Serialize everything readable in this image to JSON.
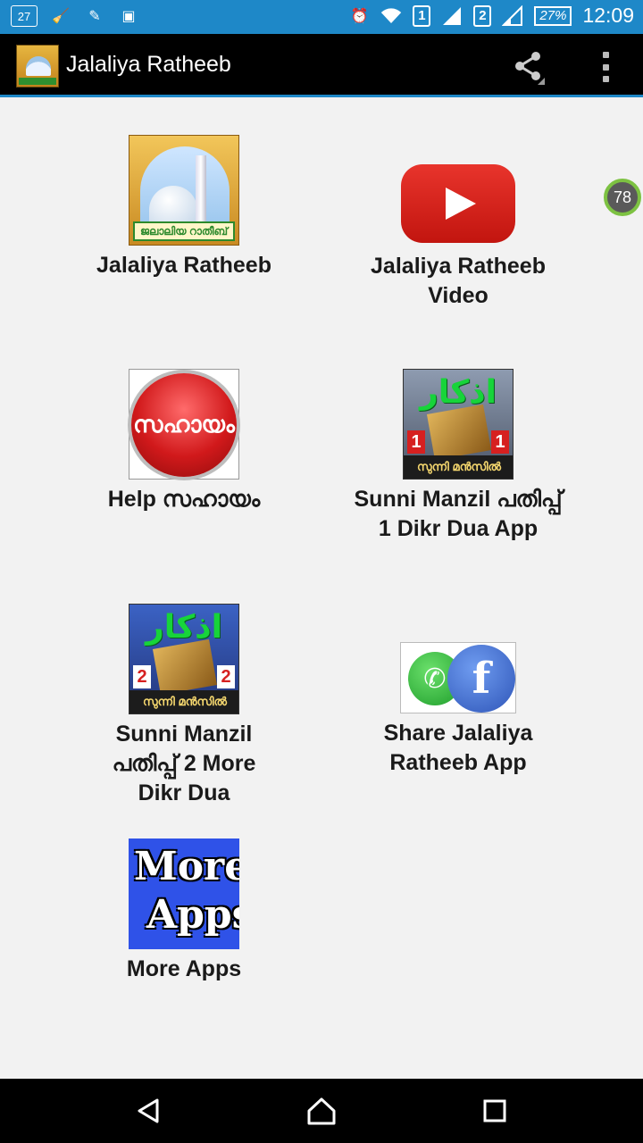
{
  "status_bar": {
    "notification_count": "27",
    "battery": "27%",
    "time": "12:09",
    "sim1": "1",
    "sim2": "2"
  },
  "app_bar": {
    "title": "Jalaliya Ratheeb"
  },
  "badge": "78",
  "tiles": [
    {
      "label": "Jalaliya Ratheeb",
      "icon": "jalaliya-ratheeb-icon",
      "caption": "ജലാലിയ റാതീബ്"
    },
    {
      "label": "Jalaliya Ratheeb Video",
      "icon": "youtube-icon"
    },
    {
      "label": "Help സഹായം",
      "icon": "help-button-icon",
      "caption": "സഹായം"
    },
    {
      "label": "Sunni Manzil പതിപ്പ് 1  Dikr Dua App",
      "icon": "sunni-manzil-1-icon",
      "arabic": "اذكار",
      "num": "1",
      "caption": "സുന്നി മൻസിൽ"
    },
    {
      "label": "Sunni Manzil പതിപ്പ് 2 More Dikr Dua",
      "icon": "sunni-manzil-2-icon",
      "arabic": "اذكار",
      "num": "2",
      "caption": "സുന്നി മൻസിൽ"
    },
    {
      "label": "Share Jalaliya Ratheeb App",
      "icon": "whatsapp-facebook-icon",
      "fb_tag": "facebook"
    },
    {
      "label": "More Apps",
      "icon": "more-apps-icon",
      "line1": "More",
      "line2": "Apps"
    }
  ],
  "colors": {
    "status_bar": "#1e88c8",
    "app_bar": "#000000",
    "background": "#f2f2f2"
  }
}
